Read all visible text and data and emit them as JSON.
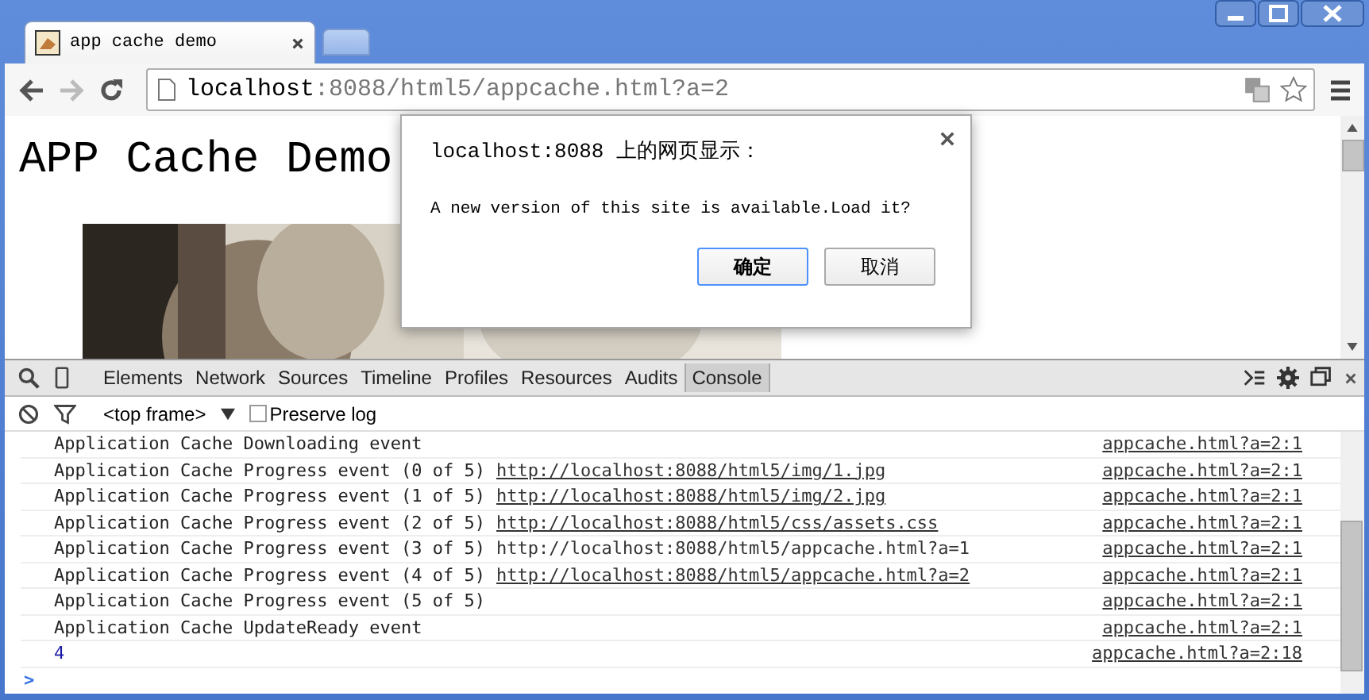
{
  "tabs": [
    {
      "title": "app cache demo",
      "selected": true
    },
    {
      "selected": false
    }
  ],
  "address_bar": {
    "host": "localhost",
    "path": ":8088/html5/appcache.html?a=2"
  },
  "page": {
    "heading": "APP Cache Demo"
  },
  "dialog": {
    "title": "localhost:8088 上的网页显示：",
    "message": "A new version of this site is available.Load it?",
    "buttons": [
      {
        "label": "确定",
        "default": true
      },
      {
        "label": "取消",
        "default": false
      }
    ]
  },
  "devtools": {
    "tabs": [
      {
        "label": "Elements",
        "selected": false
      },
      {
        "label": "Network",
        "selected": false
      },
      {
        "label": "Sources",
        "selected": false
      },
      {
        "label": "Timeline",
        "selected": false
      },
      {
        "label": "Profiles",
        "selected": false
      },
      {
        "label": "Resources",
        "selected": false
      },
      {
        "label": "Audits",
        "selected": false
      },
      {
        "label": "Console",
        "selected": true
      }
    ],
    "context": "<top frame>",
    "preserve_log": {
      "label": "Preserve log",
      "checked": false
    },
    "messages": [
      {
        "kind": "log",
        "text": "Application Cache Downloading event",
        "source": "appcache.html?a=2:1"
      },
      {
        "kind": "log",
        "text": "Application Cache Progress event (0 of 5)",
        "link": "http://localhost:8088/html5/img/1.jpg",
        "linked": true,
        "source": "appcache.html?a=2:1"
      },
      {
        "kind": "log",
        "text": "Application Cache Progress event (1 of 5)",
        "link": "http://localhost:8088/html5/img/2.jpg",
        "linked": true,
        "source": "appcache.html?a=2:1"
      },
      {
        "kind": "log",
        "text": "Application Cache Progress event (2 of 5)",
        "link": "http://localhost:8088/html5/css/assets.css",
        "linked": true,
        "source": "appcache.html?a=2:1"
      },
      {
        "kind": "log",
        "text": "Application Cache Progress event (3 of 5)",
        "link": "http://localhost:8088/html5/appcache.html?a=1",
        "linked": false,
        "source": "appcache.html?a=2:1"
      },
      {
        "kind": "log",
        "text": "Application Cache Progress event (4 of 5)",
        "link": "http://localhost:8088/html5/appcache.html?a=2",
        "linked": true,
        "source": "appcache.html?a=2:1"
      },
      {
        "kind": "log",
        "text": "Application Cache Progress event (5 of 5)",
        "source": "appcache.html?a=2:1"
      },
      {
        "kind": "log",
        "text": "Application Cache UpdateReady event",
        "source": "appcache.html?a=2:1"
      },
      {
        "kind": "value",
        "text": "4",
        "source": "appcache.html?a=2:18"
      }
    ],
    "prompt": ">"
  }
}
